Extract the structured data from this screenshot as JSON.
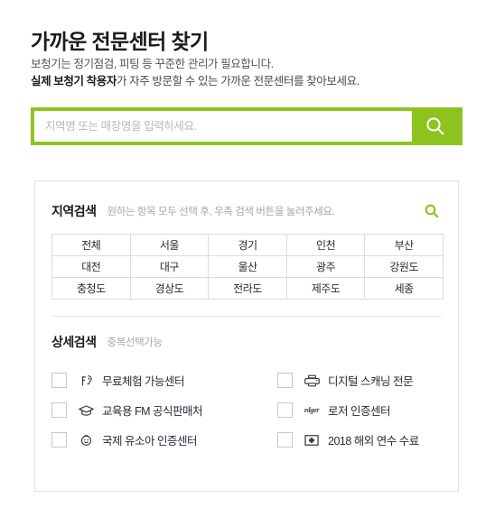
{
  "header": {
    "title": "가까운 전문센터 찾기",
    "subtitle_line1": "보청기는 정기점검, 피팅 등 꾸준한 관리가 필요합니다.",
    "subtitle_line2_strong": "실제 보청기 착용자",
    "subtitle_line2_rest": "가 자주 방문할 수 있는 가까운 전문센터를 찾아보세요."
  },
  "search": {
    "placeholder": "지역명 또는 매장명을 입력하세요.",
    "value": "",
    "button_icon": "search-icon",
    "accent_color": "#8ec31f"
  },
  "region_section": {
    "title": "지역검색",
    "hint": "원하는 항목 모두 선택 후, 우측 검색 버튼을 눌러주세요.",
    "search_icon": "search-icon",
    "search_icon_color": "#8ec31f",
    "rows": [
      [
        "전체",
        "서울",
        "경기",
        "인천",
        "부산"
      ],
      [
        "대전",
        "대구",
        "울산",
        "광주",
        "강원도"
      ],
      [
        "충청도",
        "경상도",
        "전라도",
        "제주도",
        "세종"
      ]
    ]
  },
  "detail_section": {
    "title": "상세검색",
    "hint": "중복선택가능",
    "options": [
      {
        "label": "무료체험 가능센터",
        "icon": "hearing-ear-icon",
        "icon_text": "",
        "checked": false
      },
      {
        "label": "디지털 스캐닝 전문",
        "icon": "scanner-printer-icon",
        "icon_text": "",
        "checked": false
      },
      {
        "label": "교육용 FM 공식판매처",
        "icon": "graduation-cap-icon",
        "icon_text": "",
        "checked": false
      },
      {
        "label": "로저 인증센터",
        "icon": "roger-brand-icon",
        "icon_text": "rdger",
        "checked": false
      },
      {
        "label": "국제 유소아 인증센터",
        "icon": "baby-face-icon",
        "icon_text": "",
        "checked": false
      },
      {
        "label": "2018 해외 연수 수료",
        "icon": "medical-cross-icon",
        "icon_text": "",
        "checked": false
      }
    ]
  }
}
